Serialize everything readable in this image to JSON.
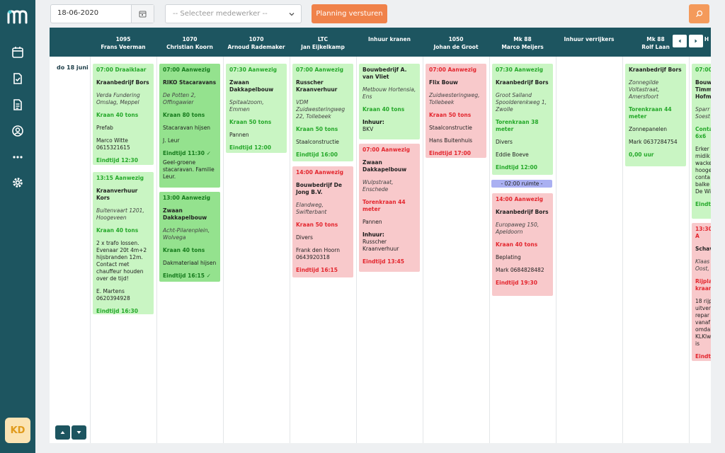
{
  "app": {
    "avatar_initials": "KD"
  },
  "sidebar": {
    "items": [
      {
        "icon": "calendar-icon"
      },
      {
        "icon": "document-check-icon"
      },
      {
        "icon": "document-list-icon"
      },
      {
        "icon": "user-circle-icon"
      },
      {
        "icon": "more-dots-icon"
      },
      {
        "icon": "gear-icon"
      }
    ]
  },
  "toolbar": {
    "date_value": "18-06-2020",
    "employee_placeholder": "-- Selecteer medewerker --",
    "send_label": "Planning versturen"
  },
  "columns": [
    {
      "code": "1095",
      "name": "Frans Veerman"
    },
    {
      "code": "1070",
      "name": "Christian Koorn"
    },
    {
      "code": "1070",
      "name": "Arnoud Rademaker"
    },
    {
      "code": "LTC",
      "name": "Jan Eijkelkamp"
    },
    {
      "code": "",
      "name": "Inhuur kranen"
    },
    {
      "code": "1050",
      "name": "Johan de Groot"
    },
    {
      "code": "Mk 88",
      "name": "Marco Meijers"
    },
    {
      "code": "",
      "name": "Inhuur verrijkers"
    },
    {
      "code": "Mk 88",
      "name": "Rolf Laan"
    },
    {
      "code": "",
      "name": "H"
    }
  ],
  "day_label": "do 18 juni",
  "ruimte_label": "- 02:00 ruimte -",
  "cards": {
    "c1a": [
      "07:00 Draaiklaar",
      "Kraanbedrijf Bors",
      "Verda Fundering Omslag, Meppel",
      "Kraan 40 tons",
      "Prefab",
      "Marco Witte 0615321615",
      "Eindtijd 12:30"
    ],
    "c1b": [
      "13:15 Aanwezig",
      "Kraanverhuur Kors",
      "Buitenvaart 1201, Hoogeveen",
      "Kraan 40 tons",
      "2 x trafo lossen. Evenaar 20t 4m+2 hijsbranden 12m. Contact met chauffeur houden over de tijd!",
      "E. Martens 0620394928",
      "Eindtijd 16:30"
    ],
    "c2a": [
      "07:00 Aanwezig",
      "RIKO Stacaravans",
      "De Potten 2, Offingawier",
      "Kraan 80 tons",
      "Stacaravan hijsen",
      "J. Leur",
      "Eindtijd 11:30 ✓",
      "Geel-groene stacaravan. Familie Leur."
    ],
    "c2b": [
      "13:00 Aanwezig",
      "Zwaan Dakkapelbouw",
      "Acht-Pilarenplein, Wolvega",
      "Kraan 40 tons",
      "Dakmateriaal hijsen",
      "Eindtijd 16:15 ✓"
    ],
    "c3a": [
      "07:30 Aanwezig",
      "Zwaan Dakkapelbouw",
      "Spitaalzoom, Emmen",
      "Kraan 50 tons",
      "Pannen",
      "Eindtijd 12:00"
    ],
    "c4a": [
      "07:00 Aanwezig",
      "Russcher Kraanverhuur",
      "VDM Zuidwesteringweg 22, Tollebeek",
      "Kraan 50 tons",
      "Staalconstructie",
      "Eindtijd 16:00"
    ],
    "c4b": [
      "14:00 Aanwezig",
      "Bouwbedrijf De Jong B.V.",
      "Elandweg, Swifterbant",
      "Kraan 50 tons",
      "Divers",
      "Frank den Hoorn 0643920318",
      "Eindtijd 16:15"
    ],
    "c5a": [
      "Bouwbedrijf A. van Vliet",
      "Metbouw Hortensia, Ens",
      "Kraan 40 tons",
      "Inhuur:",
      "BKV"
    ],
    "c5b": [
      "07:00 Aanwezig",
      "Zwaan Dakkapelbouw",
      "Wulpstraat, Enschede",
      "Torenkraan 44 meter",
      "Pannen",
      "Inhuur:",
      "Russcher Kraanverhuur",
      "Eindtijd 13:45"
    ],
    "c6a": [
      "07:00 Aanwezig",
      "Flix Bouw",
      "Zuidwesteringweg, Tollebeek",
      "Kraan 50 tons",
      "Staalconstructie",
      "Hans Buitenhuis",
      "Eindtijd 17:00"
    ],
    "c7a": [
      "07:30 Aanwezig",
      "Kraanbedrijf Bors",
      "Groot Salland Spoolderenkweg 1, Zwolle",
      "Torenkraan 38 meter",
      "Divers",
      "Eddie Boeve",
      "Eindtijd 12:00"
    ],
    "c7b": [
      "14:00 Aanwezig",
      "Kraanbedrijf Bors",
      "Europaweg 150, Apeldoorn",
      "Kraan 40 tons",
      "Beplating",
      "Mark 0684828482",
      "Eindtijd 19:30"
    ],
    "c9a": [
      "Kraanbedrijf Bors",
      "Zonnegilde Voltastraat, Amersfoort",
      "Torenkraan 44 meter",
      "Zonnepanelen",
      "Mark 0637284754",
      "0,00 uur"
    ],
    "c10a": [
      "07:00",
      "Bouw Timm Hofm",
      "Sparr Soest",
      "Conta 6x6",
      "Erker u midik wacke hooge conta balke De Wi",
      "Eindti"
    ],
    "c10b": [
      "13:30 A",
      "Schav",
      "Klaas Oost,",
      "Rijpla kraan",
      "18 rijpl uitven repar vanaf omdal KLKlw is",
      "Eindti"
    ]
  }
}
